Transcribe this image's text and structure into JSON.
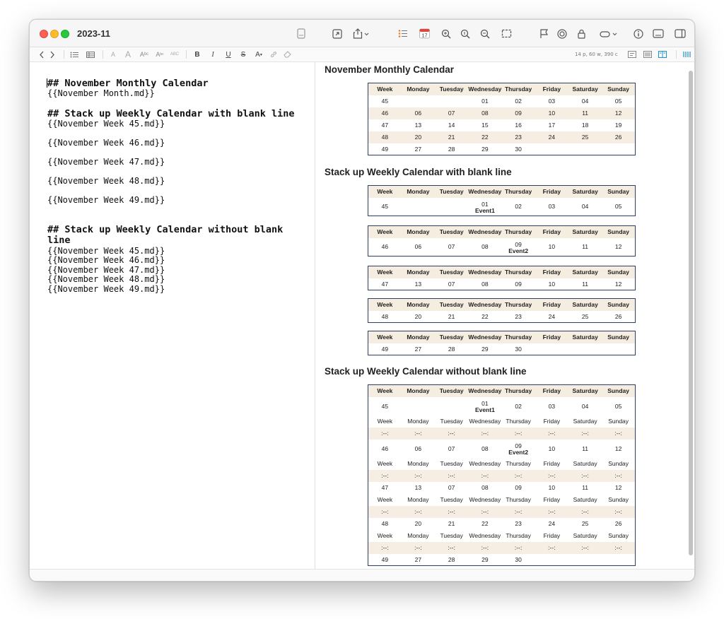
{
  "window": {
    "title": "2023-11"
  },
  "statusbar": {
    "stats": "14 p, 60 w, 390 c"
  },
  "editor": {
    "lines": [
      "## November Monthly Calendar",
      "{{November Month.md}}",
      "## Stack up Weekly Calendar with blank line",
      "{{November Week 45.md}}",
      "{{November Week 46.md}}",
      "{{November Week 47.md}}",
      "{{November Week 48.md}}",
      "{{November Week 49.md}}",
      "## Stack up Weekly Calendar without blank line",
      "{{November Week 45.md}}",
      "{{November Week 46.md}}",
      "{{November Week 47.md}}",
      "{{November Week 48.md}}",
      "{{November Week 49.md}}"
    ]
  },
  "preview": {
    "h1": "November Monthly Calendar",
    "h2": "Stack up Weekly Calendar with blank line",
    "h3": "Stack up Weekly Calendar without blank line",
    "headers": [
      "Week",
      "Monday",
      "Tuesday",
      "Wednesday",
      "Thursday",
      "Friday",
      "Saturday",
      "Sunday"
    ],
    "separator": ":--:",
    "month_rows": [
      [
        "45",
        "",
        "",
        "01",
        "02",
        "03",
        "04",
        "05"
      ],
      [
        "46",
        "06",
        "07",
        "08",
        "09",
        "10",
        "11",
        "12"
      ],
      [
        "47",
        "13",
        "14",
        "15",
        "16",
        "17",
        "18",
        "19"
      ],
      [
        "48",
        "20",
        "21",
        "22",
        "23",
        "24",
        "25",
        "26"
      ],
      [
        "49",
        "27",
        "28",
        "29",
        "30",
        "",
        "",
        ""
      ]
    ],
    "week_rows": [
      [
        "45",
        "",
        "",
        "01",
        "02",
        "03",
        "04",
        "05"
      ],
      [
        "46",
        "06",
        "07",
        "08",
        "09",
        "10",
        "11",
        "12"
      ],
      [
        "47",
        "13",
        "07",
        "08",
        "09",
        "10",
        "11",
        "12"
      ],
      [
        "48",
        "20",
        "21",
        "22",
        "23",
        "24",
        "25",
        "26"
      ],
      [
        "49",
        "27",
        "28",
        "29",
        "30",
        "",
        "",
        ""
      ]
    ],
    "events": {
      "week45": "Event1",
      "week46": "Event2"
    }
  }
}
